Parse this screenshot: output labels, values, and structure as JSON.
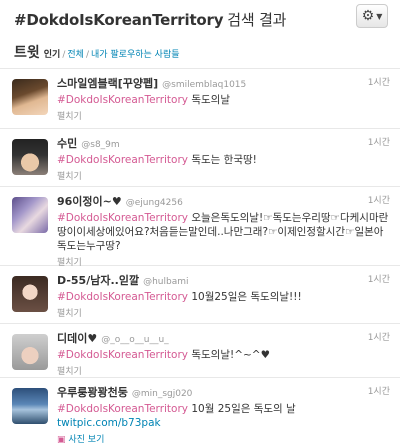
{
  "header": {
    "title": "#DokdoIsKoreanTerritory",
    "title_suffix": "검색 결과",
    "gear_icon": "gear-icon"
  },
  "tabs": {
    "main": "트윗",
    "top": "인기",
    "all": "전체",
    "following": "내가 팔로우하는 사람들"
  },
  "tweets": [
    {
      "name": "스마일엠블랙[꾸양펩]",
      "handle": "@smilemblaq1015",
      "time": "1시간",
      "hashtag": "#DokdoIsKoreanTerritory",
      "text": "독도의날",
      "expand": "펼치기"
    },
    {
      "name": "수민",
      "handle": "@s8_9m",
      "time": "1시간",
      "hashtag": "#DokdoIsKoreanTerritory",
      "text": "독도는 한국땅!",
      "expand": "펼치기"
    },
    {
      "name": "96이정이~♥",
      "handle": "@ejung4256",
      "time": "1시간",
      "hashtag": "#DokdoIsKoreanTerritory",
      "text": "오늘은독도의날!☞독도는우리땅☞다케시마란땅이이세상에있어요?처음듣는말인데..나만그래?☞이제인정할시간☞일본아독도는누구땅?",
      "expand": "펼치기"
    },
    {
      "name": "D-55/남자..읻깔",
      "handle": "@hulbami",
      "time": "1시간",
      "hashtag": "#DokdoIsKoreanTerritory",
      "text": "10월25일은 독도의날!!!",
      "expand": "펼치기"
    },
    {
      "name": "디데이♥",
      "handle": "@_o__o__u__u_",
      "time": "1시간",
      "hashtag": "#DokdoIsKoreanTerritory",
      "text": "독도의날!^~^♥",
      "expand": "펼치기"
    },
    {
      "name": "우루룽꽝꽝천둥",
      "handle": "@min_sgj020",
      "time": "1시간",
      "hashtag": "#DokdoIsKoreanTerritory",
      "text": "10월 25일은 독도의 날",
      "link": "twitpic.com/b73pak",
      "photo": "사진 보기"
    }
  ]
}
